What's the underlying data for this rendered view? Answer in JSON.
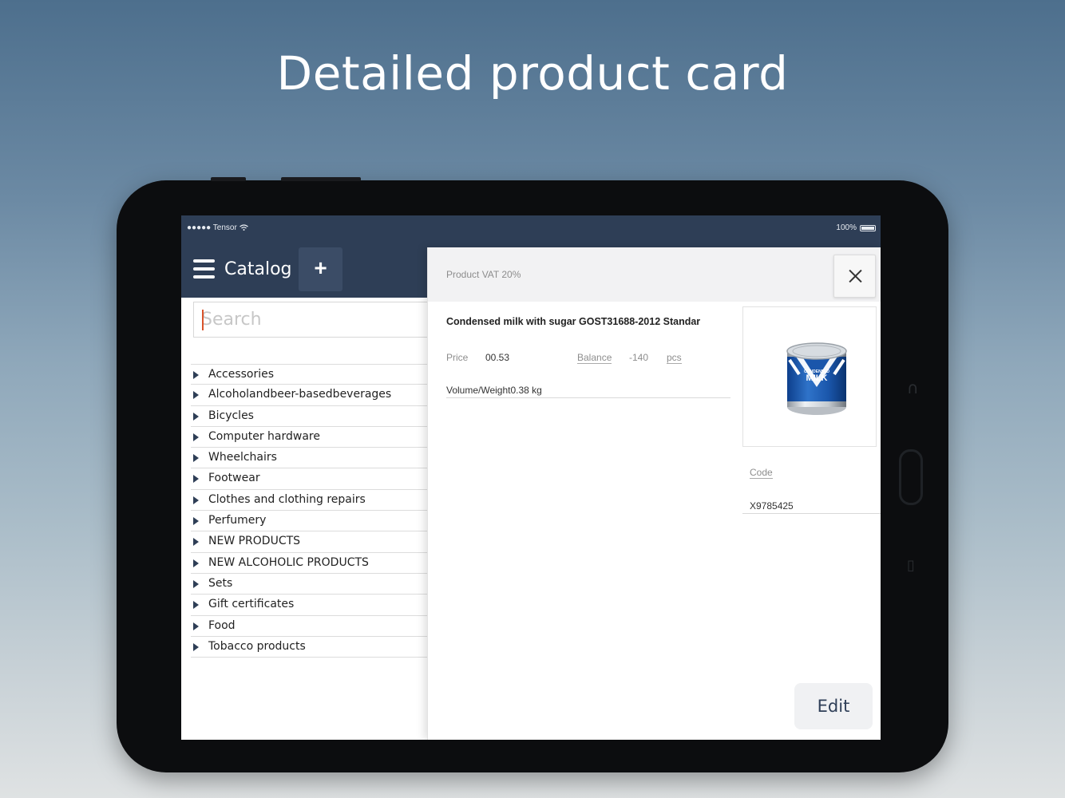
{
  "headline": "Detailed product card",
  "status_bar": {
    "carrier": "●●●●● Tensor",
    "battery": "100%"
  },
  "catalog": {
    "title": "Catalog",
    "add_label": "+",
    "search_placeholder": "Search",
    "items": [
      {
        "label": "Accessories"
      },
      {
        "label": "Alcoholandbeer-basedbeverages"
      },
      {
        "label": "Bicycles"
      },
      {
        "label": "Computer hardware"
      },
      {
        "label": "Wheelchairs"
      },
      {
        "label": "Footwear"
      },
      {
        "label": "Clothes and clothing repairs"
      },
      {
        "label": "Perfumery"
      },
      {
        "label": "NEW PRODUCTS"
      },
      {
        "label": "NEW ALCOHOLIC PRODUCTS"
      },
      {
        "label": "Sets"
      },
      {
        "label": "Gift certificates"
      },
      {
        "label": "Food"
      },
      {
        "label": "Tobacco products"
      }
    ]
  },
  "product": {
    "vat_label": "Product VAT 20%",
    "name": "Condensed milk with sugar GOST31688-2012 Standar",
    "price_label": "Price",
    "price_value": "00.53",
    "balance_label": "Balance",
    "balance_value": "-140",
    "unit": "pcs",
    "volume": "Volume/Weight0.38 kg",
    "image_brand_small": "CONDENSED",
    "image_brand_big": "MILK",
    "code_label": "Code",
    "code_value": "X9785425",
    "edit_label": "Edit"
  },
  "colors": {
    "accent_dark": "#2e3e56",
    "cursor": "#d9532b"
  }
}
